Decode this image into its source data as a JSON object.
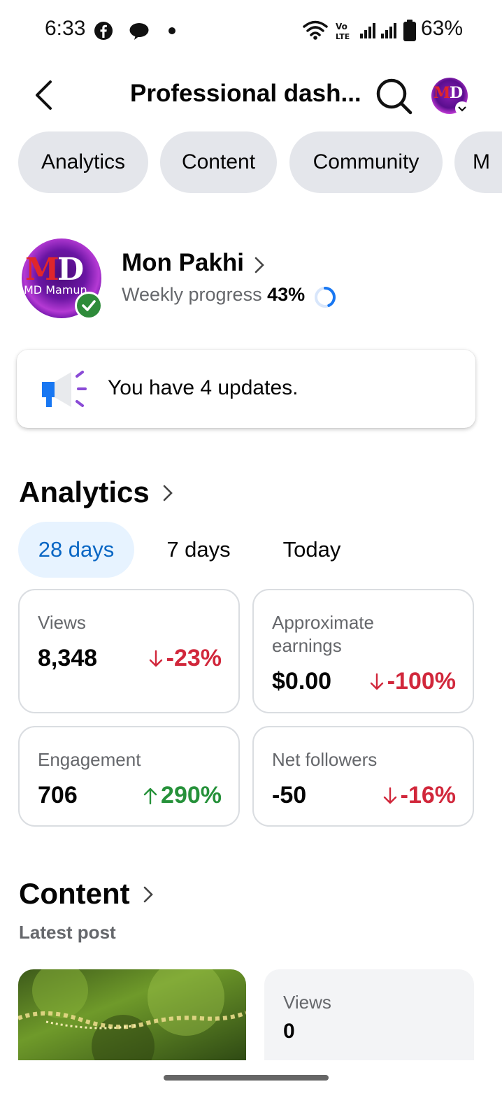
{
  "status_bar": {
    "time": "6:33",
    "battery": "63%"
  },
  "header": {
    "title": "Professional dash...",
    "back_icon": "chevron-left-icon",
    "search_icon": "search-icon"
  },
  "tabs": [
    {
      "label": "Analytics"
    },
    {
      "label": "Content"
    },
    {
      "label": "Community"
    },
    {
      "label": "M"
    }
  ],
  "profile": {
    "name": "Mon Pakhi",
    "weekly_label": "Weekly progress",
    "weekly_value": "43%",
    "weekly_fraction": 0.43,
    "avatar_text": "MD Mamun"
  },
  "updates": {
    "text": "You have 4 updates."
  },
  "analytics": {
    "title": "Analytics",
    "ranges": [
      {
        "label": "28 days",
        "active": true
      },
      {
        "label": "7 days",
        "active": false
      },
      {
        "label": "Today",
        "active": false
      }
    ],
    "stats": [
      {
        "label": "Views",
        "value": "8,348",
        "change": "-23%",
        "direction": "down"
      },
      {
        "label": "Approximate earnings",
        "value": "$0.00",
        "change": "-100%",
        "direction": "down"
      },
      {
        "label": "Engagement",
        "value": "706",
        "change": "290%",
        "direction": "up"
      },
      {
        "label": "Net followers",
        "value": "-50",
        "change": "-16%",
        "direction": "down"
      }
    ]
  },
  "content": {
    "title": "Content",
    "latest_post_label": "Latest post",
    "views_label": "Views",
    "views_value": "0"
  },
  "colors": {
    "accent": "#0866c4",
    "accent_bg": "#e7f3ff",
    "chip_bg": "#e4e6eb",
    "down": "#d1273b",
    "up": "#26913a",
    "verified": "#2e8b3a"
  }
}
